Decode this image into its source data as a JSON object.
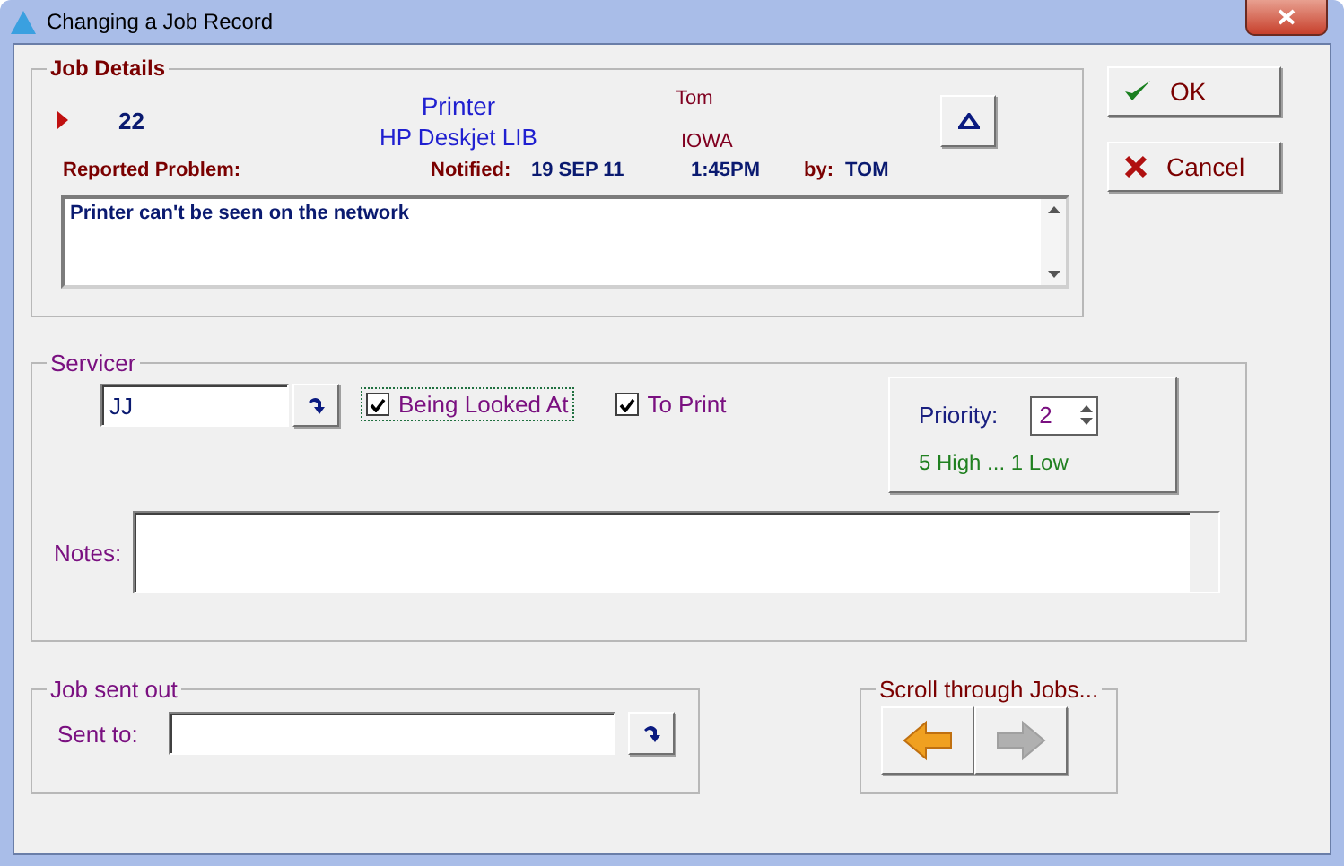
{
  "window": {
    "title": "Changing a Job Record"
  },
  "job_details": {
    "legend": "Job Details",
    "number": "22",
    "item": "Printer",
    "model": "HP Deskjet LIB",
    "user": "Tom",
    "location": "IOWA",
    "problem_label": "Reported Problem:",
    "notified_label": "Notified:",
    "date": "19 SEP 11",
    "time": "1:45PM",
    "by_label": "by:",
    "by": "TOM",
    "problem": "Printer can't be seen on the network"
  },
  "buttons": [
    {
      "label": "OK",
      "kind": "ok"
    },
    {
      "label": "Cancel",
      "kind": "cancel"
    }
  ],
  "servicer": {
    "legend": "Servicer",
    "value": "JJ",
    "checkboxes": [
      {
        "label": "Being Looked At",
        "checked": true,
        "focused": true
      },
      {
        "label": "To Print",
        "checked": true,
        "focused": false
      }
    ],
    "priority": {
      "label": "Priority:",
      "value": "2",
      "hint": "5 High ... 1 Low"
    },
    "notes_label": "Notes:"
  },
  "sent_out": {
    "legend": "Job sent out",
    "label": "Sent to:"
  },
  "scroll": {
    "legend": "Scroll through Jobs...",
    "buttons": [
      {
        "kind": "previous",
        "disabled": false
      },
      {
        "kind": "next",
        "disabled": true
      }
    ]
  }
}
